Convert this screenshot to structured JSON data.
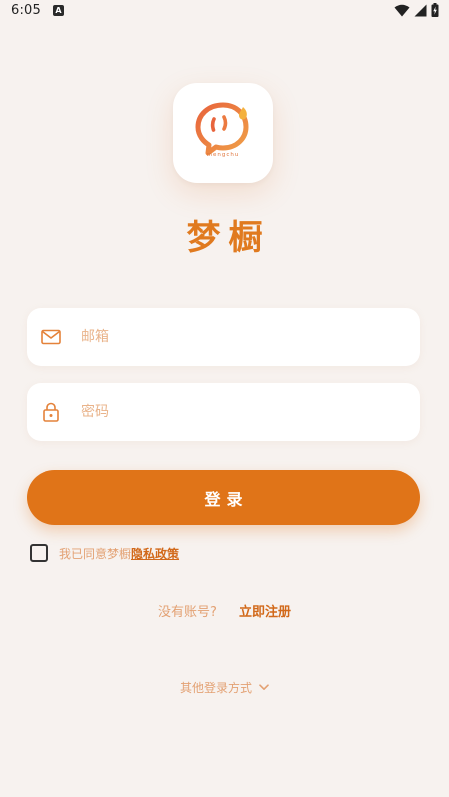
{
  "status_bar": {
    "time": "6:05",
    "notification_glyph": "A",
    "icons": [
      "wifi-icon",
      "signal-icon",
      "battery-charging-icon"
    ]
  },
  "logo": {
    "subtext": "mengchu"
  },
  "app_title": "梦橱",
  "email": {
    "placeholder": "邮箱",
    "value": "",
    "icon": "mail-icon"
  },
  "password": {
    "placeholder": "密码",
    "value": "",
    "icon": "lock-icon"
  },
  "login_button": "登录",
  "agreement": {
    "checked": false,
    "prefix": "我已同意梦橱",
    "link": "隐私政策"
  },
  "register": {
    "prompt": "没有账号?",
    "link": "立即注册"
  },
  "other_login": {
    "label": "其他登录方式",
    "icon": "chevron-down-icon"
  },
  "colors": {
    "accent": "#e07418",
    "background": "#f7f2ef",
    "placeholder": "#e9b38a"
  }
}
